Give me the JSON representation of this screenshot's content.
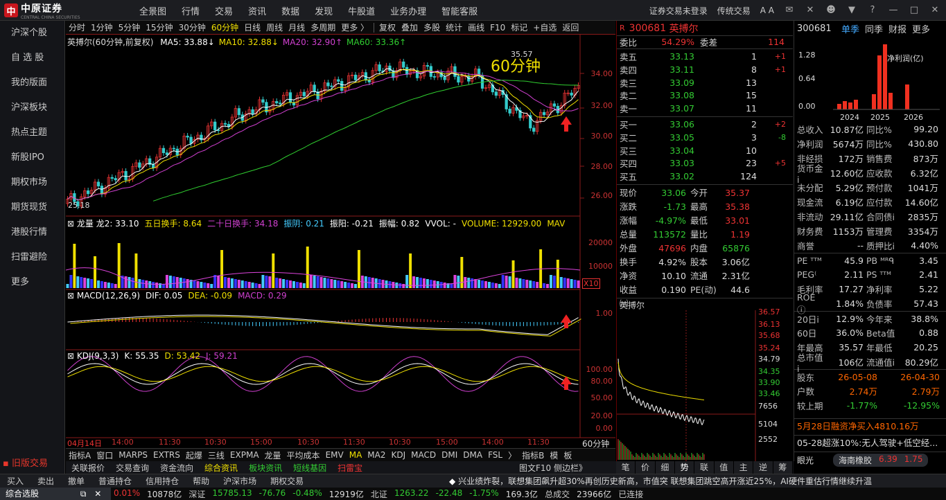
{
  "app": {
    "logo_text": "中原证券",
    "logo_sub": "CENTRAL CHINA SECURITIES"
  },
  "nav": [
    "全景图",
    "行情",
    "交易",
    "资讯",
    "数据",
    "发现",
    "牛股道",
    "业务办理",
    "智能客服"
  ],
  "top_right": {
    "login": "证券交易未登录",
    "mode": "传统交易",
    "font_btn": "A A"
  },
  "sidebar": {
    "items": [
      "沪深个股",
      "自 选 股",
      "我的版面",
      "沪深板块",
      "热点主题",
      "新股IPO",
      "期权市场",
      "期货现货",
      "港股行情",
      "扫雷避险",
      "更多"
    ],
    "old_trade": "旧版交易"
  },
  "periods": [
    "分时",
    "1分钟",
    "5分钟",
    "15分钟",
    "30分钟",
    "60分钟",
    "日线",
    "周线",
    "月线",
    "多周期",
    "更多 〉"
  ],
  "active_period": "60分钟",
  "tools": [
    "复权",
    "叠加",
    "多股",
    "统计",
    "画线",
    "F10",
    "标记",
    "+自选",
    "返回"
  ],
  "main_chart": {
    "stock_label": "英搏尔(60分钟,前复权)",
    "ma": [
      {
        "name": "MA5",
        "value": "33.88",
        "color": "#ffffff"
      },
      {
        "name": "MA10",
        "value": "32.88",
        "color": "#f0e000"
      },
      {
        "name": "MA20",
        "value": "32.90",
        "color": "#d040d0"
      },
      {
        "name": "MA60",
        "value": "33.36",
        "color": "#30d030"
      }
    ],
    "overlay_label": "60分钟",
    "high_label": "35.57",
    "low_label": "25.18",
    "y_ticks": [
      "34.00",
      "32.00",
      "30.00",
      "28.00",
      "26.00"
    ]
  },
  "vol_panel": {
    "legend": [
      {
        "t": "龙量 龙2: 33.10",
        "c": "#ffffff"
      },
      {
        "t": "五日换手: 8.64",
        "c": "#f0e000"
      },
      {
        "t": "二十日换手: 34.18",
        "c": "#d040d0"
      },
      {
        "t": "振阴: 0.21",
        "c": "#44ccff"
      },
      {
        "t": "振阳: -0.21",
        "c": "#ffffff"
      },
      {
        "t": "振幅: 0.82",
        "c": "#ffffff"
      },
      {
        "t": "VVOL: -",
        "c": "#ffffff"
      },
      {
        "t": "VOLUME: 12929.00",
        "c": "#f0e000"
      },
      {
        "t": "MAV",
        "c": "#f0e000"
      }
    ],
    "y_ticks": [
      "20000",
      "10000"
    ],
    "x10": "X10"
  },
  "macd_panel": {
    "legend": [
      {
        "t": "MACD(12,26,9)",
        "c": "#ffffff"
      },
      {
        "t": "DIF: 0.05",
        "c": "#ffffff"
      },
      {
        "t": "DEA: -0.09",
        "c": "#f0e000"
      },
      {
        "t": "MACD: 0.29",
        "c": "#d040d0"
      }
    ],
    "y_ticks": [
      "1.00"
    ]
  },
  "kdj_panel": {
    "legend": [
      {
        "t": "KDJ(9,3,3)",
        "c": "#ffffff"
      },
      {
        "t": "K: 55.35",
        "c": "#ffffff"
      },
      {
        "t": "D: 53.42",
        "c": "#f0e000"
      },
      {
        "t": "J: 59.21",
        "c": "#d040d0"
      }
    ],
    "y_ticks": [
      "100.00",
      "80.00",
      "50.00",
      "20.00",
      "0.00"
    ]
  },
  "x_axis": [
    "04月14日",
    "14:00",
    "11:30",
    "10:30",
    "15:00",
    "10:30",
    "11:30",
    "10:30",
    "15:00",
    "14:00",
    "11:30"
  ],
  "x_axis_period": "60分钟",
  "indicator_tabs": [
    "指标A",
    "窗口",
    "MARPS",
    "EXTRS",
    "起爆",
    "三线",
    "EXPMA",
    "龙量",
    "平均成本",
    "EMV",
    "MA",
    "MA2",
    "KDJ",
    "MACD",
    "DMI",
    "DMA",
    "FSL",
    "〉",
    "指标B",
    "模",
    "板"
  ],
  "bottom_links": [
    "关联报价",
    "交易查询",
    "资金流向",
    "综合资讯",
    "板块资讯",
    "短线基因",
    "扫雷宝"
  ],
  "bottom_right_link": "图文F10 侧边栏》",
  "quote": {
    "code": "300681",
    "name": "英搏尔",
    "weibi_label": "委比",
    "weibi": "54.29%",
    "weicha_label": "委差",
    "weicha": "114",
    "asks": [
      {
        "l": "卖五",
        "p": "33.13",
        "v": "1",
        "c": "+1"
      },
      {
        "l": "卖四",
        "p": "33.11",
        "v": "8",
        "c": "+1"
      },
      {
        "l": "卖三",
        "p": "33.09",
        "v": "13",
        "c": ""
      },
      {
        "l": "卖二",
        "p": "33.08",
        "v": "15",
        "c": ""
      },
      {
        "l": "卖一",
        "p": "33.07",
        "v": "11",
        "c": ""
      }
    ],
    "bids": [
      {
        "l": "买一",
        "p": "33.06",
        "v": "2",
        "c": "+2"
      },
      {
        "l": "买二",
        "p": "33.05",
        "v": "3",
        "c": "-8"
      },
      {
        "l": "买三",
        "p": "33.04",
        "v": "10",
        "c": ""
      },
      {
        "l": "买四",
        "p": "33.03",
        "v": "23",
        "c": "+5"
      },
      {
        "l": "买五",
        "p": "33.02",
        "v": "124",
        "c": ""
      }
    ],
    "stats": [
      [
        "现价",
        "33.06",
        "今开",
        "35.37"
      ],
      [
        "涨跌",
        "-1.73",
        "最高",
        "35.38"
      ],
      [
        "涨幅",
        "-4.97%",
        "最低",
        "33.01"
      ],
      [
        "总量",
        "113572",
        "量比",
        "1.19"
      ],
      [
        "外盘",
        "47696",
        "内盘",
        "65876"
      ],
      [
        "换手",
        "4.92%",
        "股本",
        "3.06亿"
      ],
      [
        "净资",
        "10.10",
        "流通",
        "2.31亿"
      ],
      [
        "收益㈠",
        "0.190",
        "PE(动)",
        "44.6"
      ]
    ],
    "mini_name": "英搏尔",
    "mini_ticks": [
      "36.57",
      "36.13",
      "35.68",
      "35.24",
      "34.79",
      "34.35",
      "33.90",
      "33.46",
      "7656",
      "5104",
      "2552"
    ]
  },
  "fund_tabs": [
    "笔",
    "价",
    "细",
    "势",
    "联",
    "值",
    "主",
    "逆",
    "筹"
  ],
  "fin": {
    "code": "300681",
    "tabs": [
      "单季",
      "同季",
      "财报",
      "更多"
    ],
    "chart_title": "净利润(亿)",
    "chart_y": [
      "1.28",
      "0.64",
      "0.00"
    ],
    "chart_x": [
      "2024",
      "2025",
      "2026"
    ],
    "rows": [
      [
        "总收入",
        "10.87亿",
        "同比%",
        "99.20"
      ],
      [
        "净利润",
        "5674万",
        "同比%",
        "430.80"
      ],
      [
        "非经损",
        "172万",
        "销售费",
        "873万"
      ],
      [
        "货币金i",
        "12.60亿",
        "应收款",
        "6.32亿"
      ],
      [
        "未分配",
        "5.29亿",
        "预付款",
        "1041万"
      ],
      [
        "现金流",
        "6.19亿",
        "应付款",
        "14.60亿"
      ],
      [
        "非流动",
        "29.11亿",
        "合同债i",
        "2835万"
      ],
      [
        "财务费",
        "1153万",
        "管理费",
        "3354万"
      ],
      [
        "商誉",
        "--",
        "质押比i",
        "4.40%"
      ],
      [
        "PE ᵀᵀᴹ",
        "45.9",
        "PB ᴹᴿᑫ",
        "3.45"
      ],
      [
        "PEG⁽",
        "2.11",
        "PS ᵀᵀᴹ",
        "2.41"
      ],
      [
        "毛利率",
        "17.27",
        "净利率",
        "5.22"
      ],
      [
        "ROE ⓘ",
        "1.84%",
        "负债率",
        "57.43"
      ],
      [
        "20日i",
        "12.9%",
        "今年来",
        "38.8%"
      ],
      [
        "60日",
        "36.0%",
        "Beta值",
        "0.88"
      ],
      [
        "年最高",
        "35.57",
        "年最低",
        "20.25"
      ],
      [
        "总市值i",
        "106亿",
        "流通值i",
        "80.29亿"
      ],
      [
        "股东",
        "26-05-08",
        "",
        "26-04-30"
      ],
      [
        "户数",
        "2.74万",
        "",
        "2.79万"
      ],
      [
        "较上期",
        "-1.77%",
        "",
        "-12.95%"
      ]
    ],
    "news1": "5月28日融资净买入4810.16万",
    "news2": "05-28超涨10%:无人驾驶+低空经...",
    "news3_label": "眼光",
    "ticker_name": "海南橡胶",
    "ticker_price": "6.39",
    "ticker_chg": "1.75"
  },
  "tradebar": [
    "买入",
    "卖出",
    "撤单",
    "普通持仓",
    "信用持仓",
    "帮助",
    "沪深市场",
    "期权交易"
  ],
  "ticker_news": "兴业绩炸裂，联想集团飙升超30%再创历史新高，市值突    联想集团跳空高开涨近25%，AI硬件重估行情继续升温",
  "status": {
    "label": "综合选股",
    "items": [
      {
        "t": "0.01%",
        "c": "#e33"
      },
      {
        "t": "10878亿",
        "c": "#ddd"
      },
      {
        "t": "深证",
        "c": "#ccc"
      },
      {
        "t": "15785.13",
        "c": "#3c3"
      },
      {
        "t": "-76.76",
        "c": "#3c3"
      },
      {
        "t": "-0.48%",
        "c": "#3c3"
      },
      {
        "t": "12919亿",
        "c": "#ddd"
      },
      {
        "t": "北证",
        "c": "#ccc"
      },
      {
        "t": "1263.22",
        "c": "#3c3"
      },
      {
        "t": "-22.48",
        "c": "#3c3"
      },
      {
        "t": "-1.75%",
        "c": "#3c3"
      },
      {
        "t": "169.3亿",
        "c": "#ddd"
      },
      {
        "t": "总成交",
        "c": "#ccc"
      },
      {
        "t": "23966亿",
        "c": "#ddd"
      },
      {
        "t": "已连接",
        "c": "#ccc"
      }
    ]
  },
  "colors": {
    "up": "#e33333",
    "down": "#33cccc",
    "ma5": "#ffffff",
    "ma10": "#f0e000",
    "ma20": "#d040d0",
    "ma60": "#30d030"
  }
}
